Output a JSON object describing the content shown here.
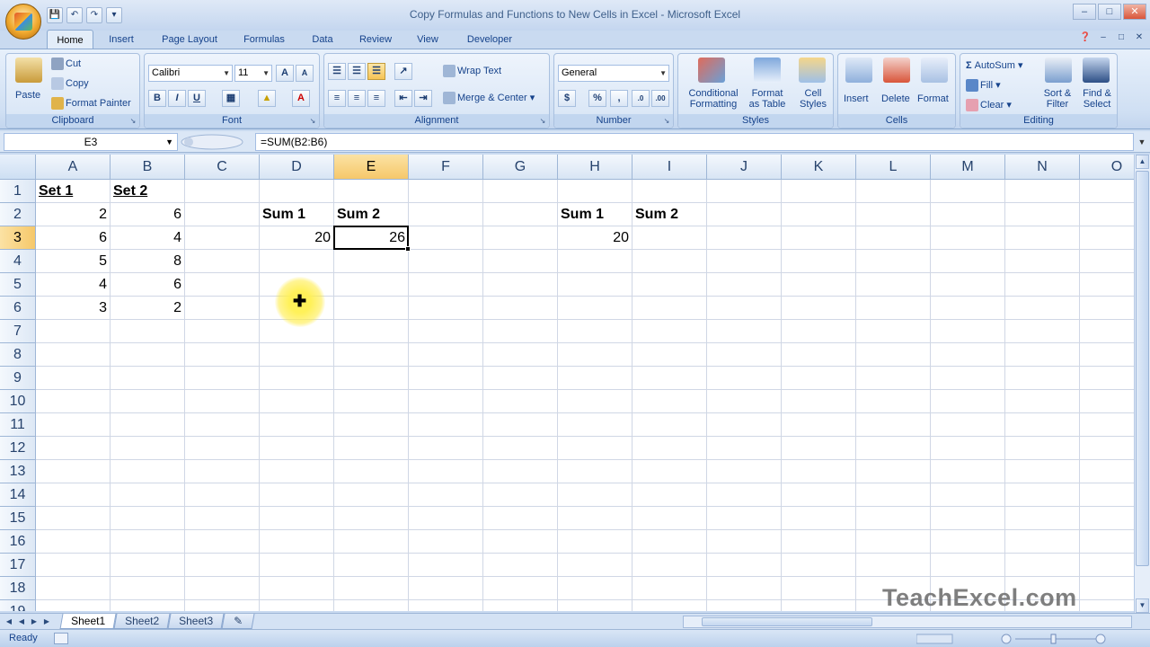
{
  "app": {
    "window_title": "Copy Formulas and Functions to New Cells in Excel - Microsoft Excel",
    "watermark": "TeachExcel.com"
  },
  "tabs": [
    "Home",
    "Insert",
    "Page Layout",
    "Formulas",
    "Data",
    "Review",
    "View",
    "Developer"
  ],
  "active_tab": "Home",
  "ribbon": {
    "clipboard": {
      "label": "Clipboard",
      "paste": "Paste",
      "cut": "Cut",
      "copy": "Copy",
      "format_painter": "Format Painter"
    },
    "font": {
      "label": "Font",
      "font_name": "Calibri",
      "font_size": "11"
    },
    "alignment": {
      "label": "Alignment",
      "wrap_text": "Wrap Text",
      "merge_center": "Merge & Center"
    },
    "number": {
      "label": "Number",
      "format": "General"
    },
    "styles": {
      "label": "Styles",
      "conditional_1": "Conditional",
      "conditional_2": "Formatting",
      "format_table_1": "Format",
      "format_table_2": "as Table",
      "cell_styles_1": "Cell",
      "cell_styles_2": "Styles"
    },
    "cells": {
      "label": "Cells",
      "insert": "Insert",
      "delete": "Delete",
      "format": "Format"
    },
    "editing": {
      "label": "Editing",
      "autosum": "AutoSum",
      "fill": "Fill",
      "clear": "Clear",
      "sort_1": "Sort &",
      "sort_2": "Filter",
      "find_1": "Find &",
      "find_2": "Select"
    }
  },
  "formula_bar": {
    "name_box": "E3",
    "formula": "=SUM(B2:B6)"
  },
  "grid": {
    "columns": [
      "A",
      "B",
      "C",
      "D",
      "E",
      "F",
      "G",
      "H",
      "I",
      "J",
      "K",
      "L",
      "M",
      "N",
      "O"
    ],
    "rows": [
      "1",
      "2",
      "3",
      "4",
      "5",
      "6",
      "7",
      "8",
      "9",
      "10",
      "11",
      "12",
      "13",
      "14",
      "15",
      "16",
      "17",
      "18",
      "19"
    ],
    "selected_column": "E",
    "selected_row": "3",
    "cells": {
      "A1": "Set 1",
      "B1": "Set 2",
      "A2": "2",
      "B2": "6",
      "A3": "6",
      "B3": "4",
      "A4": "5",
      "B4": "8",
      "A5": "4",
      "B5": "6",
      "A6": "3",
      "B6": "2",
      "D2": "Sum 1",
      "E2": "Sum 2",
      "D3": "20",
      "E3": "26",
      "H2": "Sum 1",
      "I2": "Sum 2",
      "H3": "20"
    }
  },
  "sheets": [
    "Sheet1",
    "Sheet2",
    "Sheet3"
  ],
  "active_sheet": "Sheet1",
  "status": {
    "text": "Ready"
  }
}
